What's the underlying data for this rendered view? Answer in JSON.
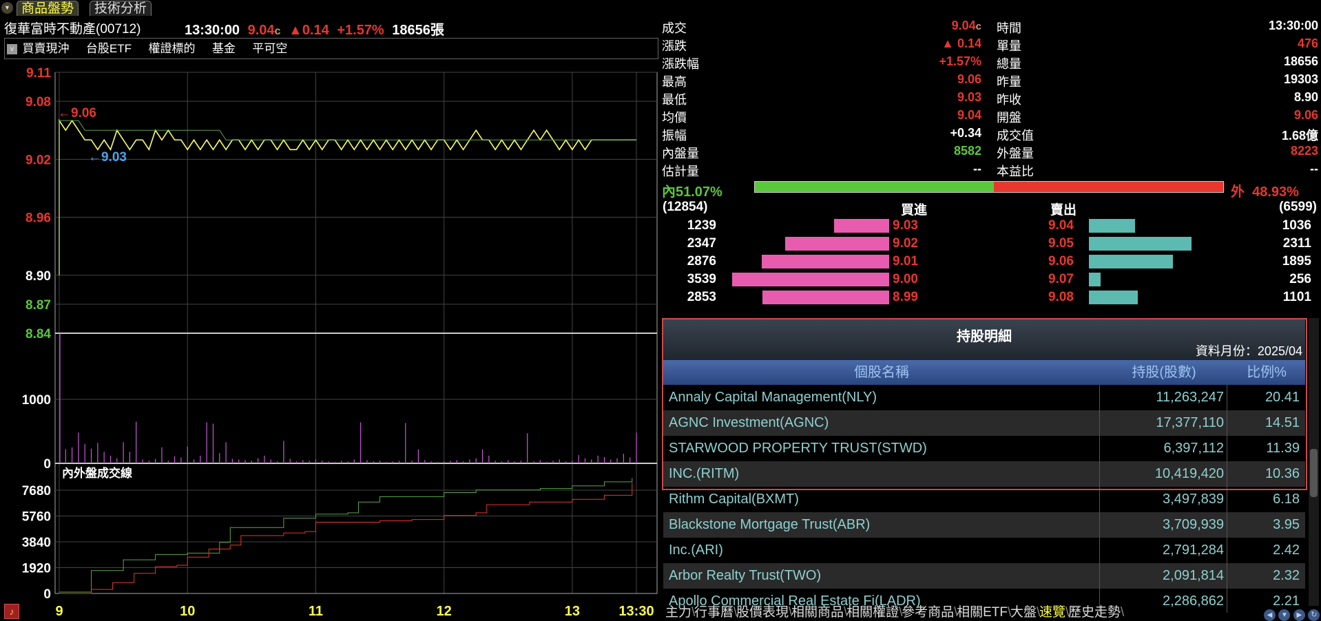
{
  "tabs": [
    {
      "label": "商品盤勢",
      "active": true
    },
    {
      "label": "技術分析",
      "active": false
    }
  ],
  "quote": {
    "name": "復華富時不動產(00712)",
    "time": "13:30:00",
    "price": "9.04",
    "price_flag": "c",
    "change_arrow": "▲",
    "change": "0.14",
    "change_pct": "+1.57%",
    "volume": "18656張"
  },
  "menu": {
    "toggle_icon": "chevron-down-icon",
    "items": [
      "買賣現沖",
      "台股ETF",
      "權證標的",
      "基金",
      "平可空"
    ]
  },
  "stats": {
    "left": [
      {
        "label": "成交",
        "value": "9.04",
        "suffix": "c",
        "color": "#e8372c"
      },
      {
        "label": "漲跌",
        "value": "▲ 0.14",
        "color": "#e8372c"
      },
      {
        "label": "漲跌幅",
        "value": "+1.57%",
        "color": "#e8372c"
      },
      {
        "label": "最高",
        "value": "9.06",
        "color": "#e8372c"
      },
      {
        "label": "最低",
        "value": "9.03",
        "color": "#e8372c"
      },
      {
        "label": "均價",
        "value": "9.04",
        "color": "#e8372c"
      },
      {
        "label": "振幅",
        "value": "+0.34",
        "color": "#ffffff"
      },
      {
        "label": "內盤量",
        "value": "8582",
        "color": "#5ac83c"
      },
      {
        "label": "估計量",
        "value": "--",
        "color": "#ffffff"
      }
    ],
    "right": [
      {
        "label": "時間",
        "value": "13:30:00",
        "color": "#ffffff"
      },
      {
        "label": "單量",
        "value": "476",
        "color": "#e8372c"
      },
      {
        "label": "總量",
        "value": "18656",
        "color": "#ffffff"
      },
      {
        "label": "昨量",
        "value": "19303",
        "color": "#ffffff"
      },
      {
        "label": "昨收",
        "value": "8.90",
        "color": "#ffffff"
      },
      {
        "label": "開盤",
        "value": "9.06",
        "color": "#e8372c"
      },
      {
        "label": "成交值",
        "value": "1.68億",
        "color": "#ffffff"
      },
      {
        "label": "外盤量",
        "value": "8223",
        "color": "#e8372c"
      },
      {
        "label": "本益比",
        "value": "--",
        "color": "#ffffff"
      }
    ]
  },
  "ratio": {
    "inner_label": "內",
    "inner_pct": "51.07%",
    "outer_label": "外",
    "outer_pct": "48.93%",
    "inner_fraction": 0.5107
  },
  "book": {
    "bid_total": "(12854)",
    "bid_header": "買進",
    "ask_header": "賣出",
    "ask_total": "(6599)",
    "rows": [
      {
        "bid_qty": 1239,
        "bid": "9.03",
        "ask": "9.04",
        "ask_qty": 1036
      },
      {
        "bid_qty": 2347,
        "bid": "9.02",
        "ask": "9.05",
        "ask_qty": 2311
      },
      {
        "bid_qty": 2876,
        "bid": "9.01",
        "ask": "9.06",
        "ask_qty": 1895
      },
      {
        "bid_qty": 3539,
        "bid": "9.00",
        "ask": "9.07",
        "ask_qty": 256
      },
      {
        "bid_qty": 2853,
        "bid": "8.99",
        "ask": "9.08",
        "ask_qty": 1101
      }
    ]
  },
  "holdings": {
    "title": "持股明細",
    "month": "資料月份：2025/04",
    "headers": [
      "個股名稱",
      "持股(股數)",
      "比例%"
    ],
    "rows": [
      [
        "Annaly Capital Management(NLY)",
        "11,263,247",
        "20.41"
      ],
      [
        "AGNC Investment(AGNC)",
        "17,377,110",
        "14.51"
      ],
      [
        "STARWOOD PROPERTY TRUST(STWD)",
        "6,397,112",
        "11.39"
      ],
      [
        "INC.(RITM)",
        "10,419,420",
        "10.36"
      ],
      [
        "Rithm Capital(BXMT)",
        "3,497,839",
        "6.18"
      ],
      [
        "Blackstone Mortgage Trust(ABR)",
        "3,709,939",
        "3.95"
      ],
      [
        "Inc.(ARI)",
        "2,791,284",
        "2.42"
      ],
      [
        "Arbor Realty Trust(TWO)",
        "2,091,814",
        "2.32"
      ],
      [
        "Apollo Commercial Real Estate Fi(LADR)",
        "2,286,862",
        "2.21"
      ]
    ]
  },
  "bottom_tabs": [
    {
      "label": "主力"
    },
    {
      "label": "行事曆"
    },
    {
      "label": "股價表現"
    },
    {
      "label": "相關商品"
    },
    {
      "label": "相關權證"
    },
    {
      "label": "參考商品"
    },
    {
      "label": "相關ETF"
    },
    {
      "label": "大盤"
    },
    {
      "label": "速覽",
      "active": true
    },
    {
      "label": "歷史走勢"
    }
  ],
  "chart_data": [
    {
      "type": "line",
      "panel": "price",
      "ylim": [
        8.84,
        9.11
      ],
      "yticks": [
        "9.11",
        "9.08",
        "9.02",
        "8.96",
        "8.90",
        "8.87",
        "8.84"
      ],
      "ref_price": 8.9,
      "xticks": [
        "9",
        "10",
        "11",
        "12",
        "13",
        "13:30"
      ],
      "high_label": "←9.06",
      "low_label": "←9.03",
      "interval_minutes": 3,
      "series": [
        {
          "color": "#ffff66",
          "values": [
            9.06,
            9.05,
            9.06,
            9.05,
            9.04,
            9.04,
            9.03,
            9.04,
            9.03,
            9.05,
            9.04,
            9.03,
            9.04,
            9.04,
            9.03,
            9.05,
            9.04,
            9.05,
            9.04,
            9.04,
            9.03,
            9.04,
            9.03,
            9.04,
            9.03,
            9.04,
            9.03,
            9.04,
            9.04,
            9.03,
            9.04,
            9.03,
            9.04,
            9.04,
            9.03,
            9.04,
            9.03,
            9.03,
            9.04,
            9.03,
            9.04,
            9.03,
            9.04,
            9.04,
            9.03,
            9.04,
            9.03,
            9.04,
            9.03,
            9.04,
            9.03,
            9.04,
            9.03,
            9.04,
            9.03,
            9.04,
            9.03,
            9.04,
            9.03,
            9.04,
            9.04,
            9.03,
            9.04,
            9.03,
            9.04,
            9.05,
            9.04,
            9.04,
            9.03,
            9.04,
            9.03,
            9.04,
            9.03,
            9.04,
            9.05,
            9.04,
            9.05,
            9.04,
            9.03,
            9.04,
            9.03,
            9.04,
            9.03,
            9.04,
            9.04,
            9.04,
            9.04,
            9.04,
            9.04,
            9.04,
            9.04
          ]
        },
        {
          "color": "#5aa84a",
          "values": [
            9.06,
            9.06,
            9.06,
            9.06,
            9.05,
            9.05,
            9.05,
            9.05,
            9.05,
            9.05,
            9.05,
            9.05,
            9.05,
            9.05,
            9.05,
            9.05,
            9.05,
            9.05,
            9.05,
            9.05,
            9.05,
            9.05,
            9.05,
            9.05,
            9.05,
            9.05,
            9.04,
            9.04,
            9.04,
            9.04,
            9.04,
            9.04,
            9.04,
            9.04,
            9.04,
            9.04,
            9.04,
            9.04,
            9.04,
            9.04,
            9.04,
            9.04,
            9.04,
            9.04,
            9.04,
            9.04,
            9.04,
            9.04,
            9.04,
            9.04,
            9.04,
            9.04,
            9.04,
            9.04,
            9.04,
            9.04,
            9.04,
            9.04,
            9.04,
            9.04,
            9.04,
            9.04,
            9.04,
            9.04,
            9.04,
            9.04,
            9.04,
            9.04,
            9.04,
            9.04,
            9.04,
            9.04,
            9.04,
            9.04,
            9.04,
            9.04,
            9.04,
            9.04,
            9.04,
            9.04,
            9.04,
            9.04,
            9.04,
            9.04,
            9.04,
            9.04,
            9.04,
            9.04,
            9.04,
            9.04,
            9.04
          ]
        }
      ]
    },
    {
      "type": "bar",
      "panel": "volume",
      "yticks": [
        "1000",
        "0"
      ],
      "color": "#cc55dd",
      "interval_minutes": 3,
      "values": [
        2100,
        220,
        250,
        480,
        300,
        230,
        320,
        180,
        120,
        80,
        330,
        180,
        650,
        60,
        40,
        70,
        250,
        40,
        110,
        90,
        260,
        60,
        120,
        640,
        620,
        160,
        330,
        70,
        60,
        50,
        40,
        80,
        120,
        60,
        30,
        350,
        70,
        30,
        50,
        40,
        60,
        40,
        30,
        20,
        40,
        30,
        60,
        640,
        50,
        30,
        40,
        20,
        30,
        40,
        630,
        40,
        220,
        50,
        30,
        20,
        30,
        40,
        50,
        30,
        60,
        80,
        220,
        120,
        40,
        30,
        50,
        30,
        40,
        470,
        30,
        50,
        20,
        40,
        60,
        30,
        40,
        130,
        80,
        60,
        120,
        100,
        60,
        80,
        150,
        90,
        480
      ]
    },
    {
      "type": "line",
      "panel": "inner-outer",
      "title": "內外盤成交線",
      "yticks": [
        "7680",
        "5760",
        "3840",
        "1920",
        "0"
      ],
      "series": [
        {
          "color": "#5aa84a",
          "points": [
            [
              "09:00",
              100
            ],
            [
              "09:15",
              1700
            ],
            [
              "09:30",
              2500
            ],
            [
              "09:45",
              2900
            ],
            [
              "10:00",
              3000
            ],
            [
              "10:15",
              3800
            ],
            [
              "10:20",
              4900
            ],
            [
              "10:45",
              5600
            ],
            [
              "11:00",
              5900
            ],
            [
              "11:15",
              6000
            ],
            [
              "11:20",
              6800
            ],
            [
              "11:30",
              7200
            ],
            [
              "12:00",
              7500
            ],
            [
              "12:15",
              7700
            ],
            [
              "12:45",
              7800
            ],
            [
              "13:00",
              8000
            ],
            [
              "13:15",
              8300
            ],
            [
              "13:28",
              8582
            ]
          ]
        },
        {
          "color": "#e8372c",
          "points": [
            [
              "09:00",
              0
            ],
            [
              "09:15",
              300
            ],
            [
              "09:25",
              800
            ],
            [
              "09:35",
              1500
            ],
            [
              "09:45",
              2000
            ],
            [
              "09:55",
              2100
            ],
            [
              "10:00",
              2700
            ],
            [
              "10:10",
              3300
            ],
            [
              "10:20",
              3600
            ],
            [
              "10:25",
              4300
            ],
            [
              "10:45",
              4500
            ],
            [
              "10:55",
              4600
            ],
            [
              "11:00",
              5300
            ],
            [
              "11:30",
              5400
            ],
            [
              "11:45",
              5500
            ],
            [
              "12:00",
              5800
            ],
            [
              "12:15",
              6000
            ],
            [
              "12:20",
              6600
            ],
            [
              "12:40",
              6800
            ],
            [
              "13:00",
              7000
            ],
            [
              "13:15",
              7300
            ],
            [
              "13:28",
              8223
            ]
          ]
        }
      ]
    }
  ]
}
